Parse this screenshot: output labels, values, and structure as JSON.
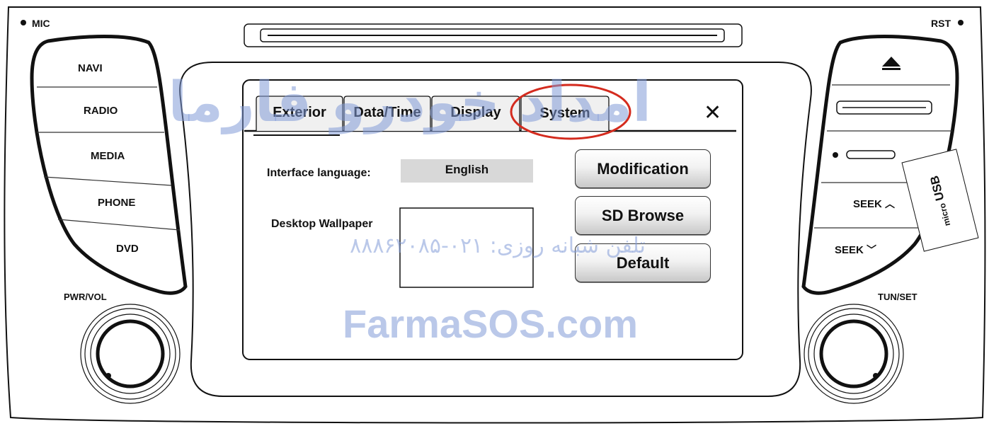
{
  "head_unit": {
    "mic_label": "MIC",
    "rst_label": "RST",
    "pwr_vol_label": "PWR/VOL",
    "tun_set_label": "TUN/SET",
    "left_buttons": [
      "NAVI",
      "RADIO",
      "MEDIA",
      "PHONE",
      "DVD"
    ],
    "seek_up_label": "SEEK",
    "seek_down_label": "SEEK",
    "micro_usb_label_micro": "micro",
    "micro_usb_label_usb": "USB"
  },
  "screen": {
    "tabs": [
      "Exterior",
      "Data/Time",
      "Display",
      "System"
    ],
    "active_tab": "Exterior",
    "highlighted_tab": "System",
    "close_glyph": "✕",
    "interface_language_label": "Interface language:",
    "interface_language_value": "English",
    "desktop_wallpaper_label": "Desktop Wallpaper",
    "buttons": {
      "modification": "Modification",
      "sd_browse": "SD Browse",
      "default": "Default"
    }
  },
  "watermark": {
    "persian_brand": "امداد خودرو فارما",
    "phone": "تلفن شبانه روزی: ۰۲۱-۸۸۸۶۲۰۸۵",
    "site": "FarmaSOS.com"
  },
  "colors": {
    "highlight_ellipse": "#d42b1e",
    "watermark": "#8fa5d8",
    "outline": "#111111"
  }
}
